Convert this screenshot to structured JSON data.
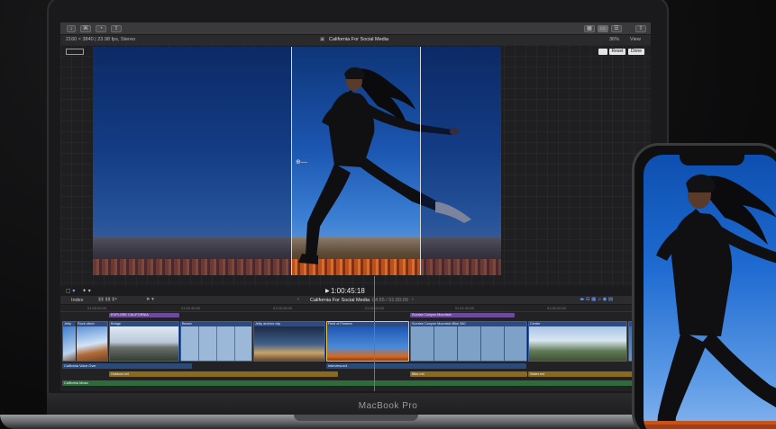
{
  "device": {
    "laptop_brand": "MacBook Pro"
  },
  "viewer": {
    "format": "2160 × 3840 | 23.98 fps, Stereo",
    "project_title": "California For Social Media",
    "zoom": "36%",
    "view_menu": "View",
    "reset_label": "Reset",
    "done_label": "Done"
  },
  "transport": {
    "timecode": "1:00:45:18"
  },
  "index_bar": {
    "index_label": "Index",
    "project_title": "California For Social Media",
    "duration": "04:55 / 01:00:00"
  },
  "ruler": {
    "ticks": [
      "01:00:00:00",
      "01:00:30:00",
      "01:00:45:00",
      "01:01:00:00",
      "01:01:30:00",
      "01:02:00:00"
    ]
  },
  "timeline": {
    "titles": [
      {
        "label": "EXPLORE CALIFORNIA"
      },
      {
        "label": "Sunrise Canyon Mountain"
      }
    ],
    "video_clips": [
      {
        "label": "Jetty"
      },
      {
        "label": "Rock climb"
      },
      {
        "label": "Bridge"
      },
      {
        "label": "Beach"
      },
      {
        "label": "Jetty archive clip"
      },
      {
        "label": "Field of Flowers"
      },
      {
        "label": "Sunrise Canyon Mountain Bike 360"
      },
      {
        "label": "Center"
      }
    ],
    "audio_clips": [
      {
        "label": "California Voice Over"
      },
      {
        "label": "Interview.m4"
      },
      {
        "label": "Outdoor.m4"
      },
      {
        "label": "Bike.m4"
      },
      {
        "label": "Water.m4"
      },
      {
        "label": "California Music"
      }
    ]
  },
  "colors": {
    "title_clip": "#6b4b9a",
    "video_clip": "#2d4b7e",
    "audio_blue": "#2a4a7a",
    "audio_gold": "#8a6a1e",
    "audio_green": "#2e6b3a",
    "playhead": "#e24a3a"
  }
}
